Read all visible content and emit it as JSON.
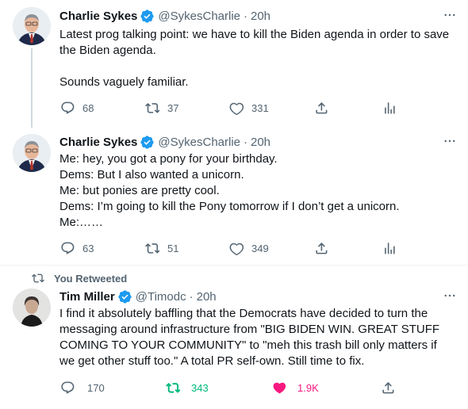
{
  "tweets": [
    {
      "name": "Charlie Sykes",
      "handle": "@SykesCharlie",
      "dot": "·",
      "time": "20h",
      "text": "Latest prog talking point: we have to kill the Biden agenda in order to save the Biden agenda.\n\nSounds vaguely familiar.",
      "replies": "68",
      "retweets": "37",
      "likes": "331"
    },
    {
      "name": "Charlie Sykes",
      "handle": "@SykesCharlie",
      "dot": "·",
      "time": "20h",
      "text": "Me: hey, you got a pony for your birthday.\nDems: But I also wanted a unicorn.\nMe: but ponies are pretty cool.\nDems: I’m going to kill the Pony tomorrow if I don’t get a unicorn.\nMe:……",
      "replies": "63",
      "retweets": "51",
      "likes": "349"
    },
    {
      "retweeted_label": "You Retweeted",
      "name": "Tim Miller",
      "handle": "@Timodc",
      "dot": "·",
      "time": "20h",
      "text": "I find it absolutely baffling that the Democrats have decided to turn the messaging around infrastructure from \"BIG BIDEN WIN. GREAT STUFF COMING TO YOUR COMMUNITY\" to \"meh this trash bill only matters if we get other stuff too.\" A total PR self-own. Still time to fix.",
      "replies": "170",
      "retweets": "343",
      "likes": "1.9K"
    }
  ],
  "colors": {
    "verified": "#1d9bf0",
    "secondary_text": "#536471",
    "retweet_active": "#00ba7c",
    "like_active": "#f91880"
  },
  "icons": [
    "verified-badge-icon",
    "more-icon",
    "reply-icon",
    "retweet-icon",
    "like-icon",
    "share-icon",
    "analytics-icon"
  ]
}
